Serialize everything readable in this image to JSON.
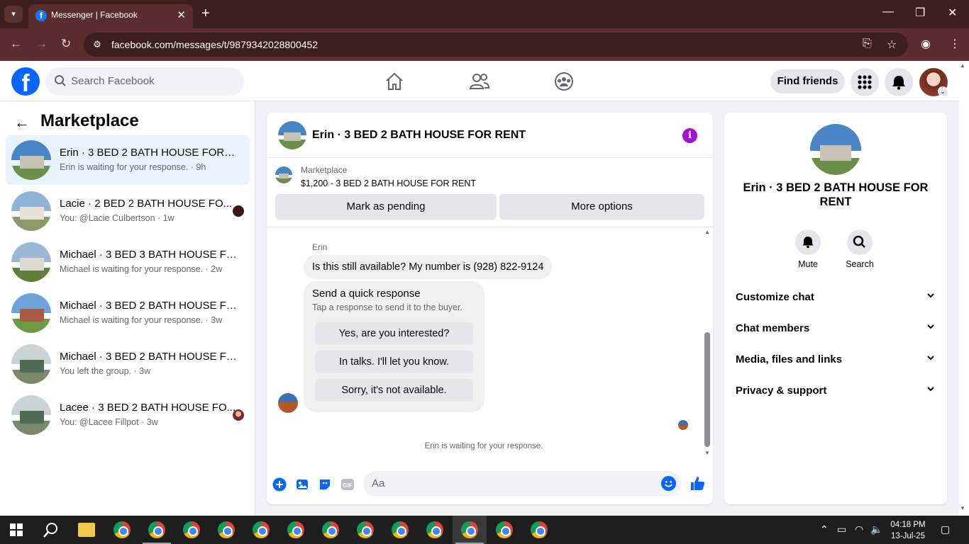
{
  "browser": {
    "tab_title": "Messenger | Facebook",
    "url": "facebook.com/messages/t/9879342028800452"
  },
  "facebook": {
    "search_placeholder": "Search Facebook",
    "find_friends": "Find friends"
  },
  "sidebar": {
    "title": "Marketplace",
    "conversations": [
      {
        "name": "Erin · 3 BED 2 BATH HOUSE FOR R...",
        "preview": "Erin is waiting for your response. · 9h",
        "active": true
      },
      {
        "name": "Lacie · 2 BED 2 BATH HOUSE FO...",
        "preview": "You: @Lacie Culbertson · 1w"
      },
      {
        "name": "Michael · 3 BED 3 BATH HOUSE FO...",
        "preview": "Michael is waiting for your response. · 2w"
      },
      {
        "name": "Michael · 3 BED 2 BATH HOUSE FO...",
        "preview": "Michael is waiting for your response. · 3w"
      },
      {
        "name": "Michael · 3 BED 2 BATH HOUSE FO...",
        "preview": "You left the group. · 3w"
      },
      {
        "name": "Lacee · 3 BED 2 BATH HOUSE FO...",
        "preview": "You: @Lacee Fillpot · 3w"
      }
    ]
  },
  "chat": {
    "title": "Erin · 3 BED 2 BATH HOUSE FOR RENT",
    "marketplace_label": "Marketplace",
    "listing": "$1,200 - 3 BED 2 BATH HOUSE FOR RENT",
    "mark_pending": "Mark as pending",
    "more_options": "More options",
    "sender": "Erin",
    "message": "Is this still available? My number is (928) 822-9124",
    "quick_title": "Send a quick response",
    "quick_sub": "Tap a response to send it to the buyer.",
    "quick_replies": [
      "Yes, are you interested?",
      "In talks. I'll let you know.",
      "Sorry, it's not available."
    ],
    "waiting": "Erin is waiting for your response.",
    "input_placeholder": "Aa"
  },
  "details": {
    "title": "Erin · 3 BED 2 BATH HOUSE FOR RENT",
    "mute": "Mute",
    "search": "Search",
    "sections": [
      "Customize chat",
      "Chat members",
      "Media, files and links",
      "Privacy & support"
    ]
  },
  "taskbar": {
    "time": "04:18 PM",
    "date": "13-Jul-25"
  },
  "colors": {
    "fb_blue": "#0866ff",
    "active_row": "#e7f3ff",
    "info_purple": "#a40ed9",
    "chrome_frame": "#5c2d2d"
  }
}
